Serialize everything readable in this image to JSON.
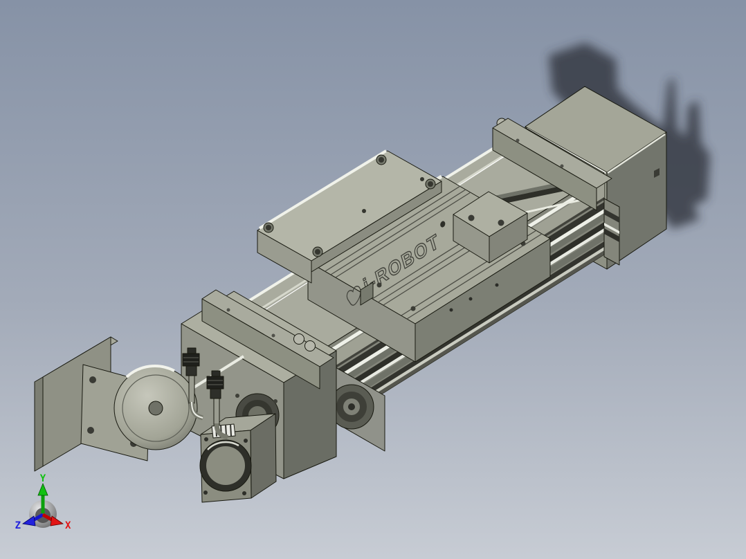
{
  "viewport": {
    "kind": "3d-cad-viewport",
    "background_top_color": "#8692a6",
    "background_mid_color": "#a3abb9",
    "background_bottom_color": "#c7ccd4",
    "cast_shadow_color": "#2e333a"
  },
  "model": {
    "engraving_brand": "i-ROBOT",
    "palette": {
      "face_top": "#a9ab9e",
      "face_top_light": "#b4b6a8",
      "face_front": "#93958a",
      "face_side": "#84867b",
      "face_dark": "#6f7268",
      "groove_dark": "#33342e",
      "edge_highlight": "#eff1e9",
      "outline": "#181910",
      "connector_dark": "#1f201c",
      "connector_metal": "#84867a"
    }
  },
  "axis_triad": {
    "x_label": "X",
    "y_label": "Y",
    "z_label": "Z",
    "x_color": "#e21414",
    "y_color": "#12c112",
    "z_color": "#2222dd",
    "sphere_color": "#8a8a8a"
  }
}
